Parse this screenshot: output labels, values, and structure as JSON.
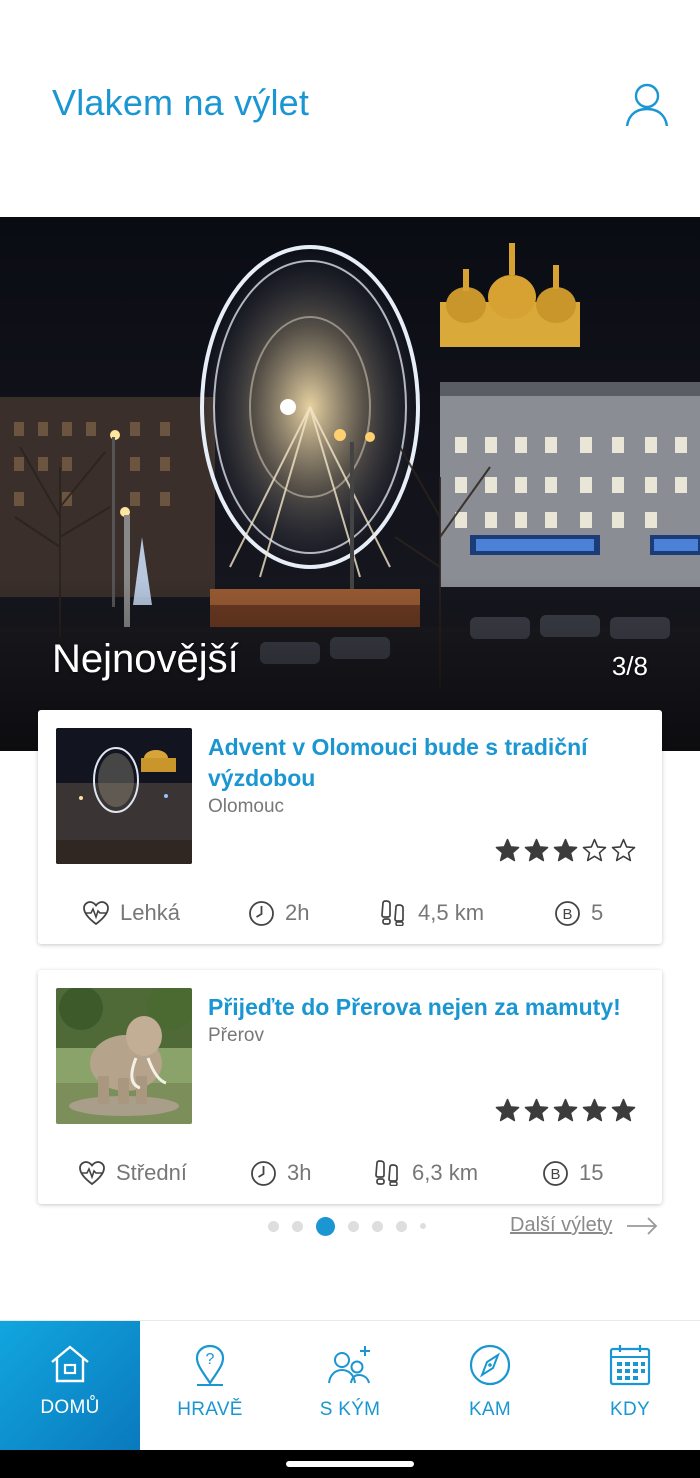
{
  "header": {
    "title": "Vlakem na výlet",
    "profile_icon": "user-icon"
  },
  "hero": {
    "label": "Nejnovější",
    "counter": "3/8"
  },
  "cards": [
    {
      "title": "Advent v Olomouci bude s tradiční výzdobou",
      "place": "Olomouc",
      "rating": 3,
      "rating_max": 5,
      "difficulty": "Lehká",
      "duration": "2h",
      "distance": "4,5 km",
      "points": "5"
    },
    {
      "title": "Přijeďte do Přerova nejen za mamuty!",
      "place": "Přerov",
      "rating": 5,
      "rating_max": 5,
      "difficulty": "Střední",
      "duration": "3h",
      "distance": "6,3 km",
      "points": "15"
    }
  ],
  "pager": {
    "count": 7,
    "active": 2
  },
  "more_link": "Další výlety",
  "nav": [
    {
      "label": "DOMŮ",
      "icon": "home-icon",
      "active": true
    },
    {
      "label": "HRAVĚ",
      "icon": "map-pin-question-icon",
      "active": false
    },
    {
      "label": "S KÝM",
      "icon": "add-people-icon",
      "active": false
    },
    {
      "label": "KAM",
      "icon": "compass-icon",
      "active": false
    },
    {
      "label": "KDY",
      "icon": "calendar-icon",
      "active": false
    }
  ],
  "colors": {
    "accent": "#1a96d2",
    "star": "#3c3c3c",
    "muted": "#777777"
  }
}
